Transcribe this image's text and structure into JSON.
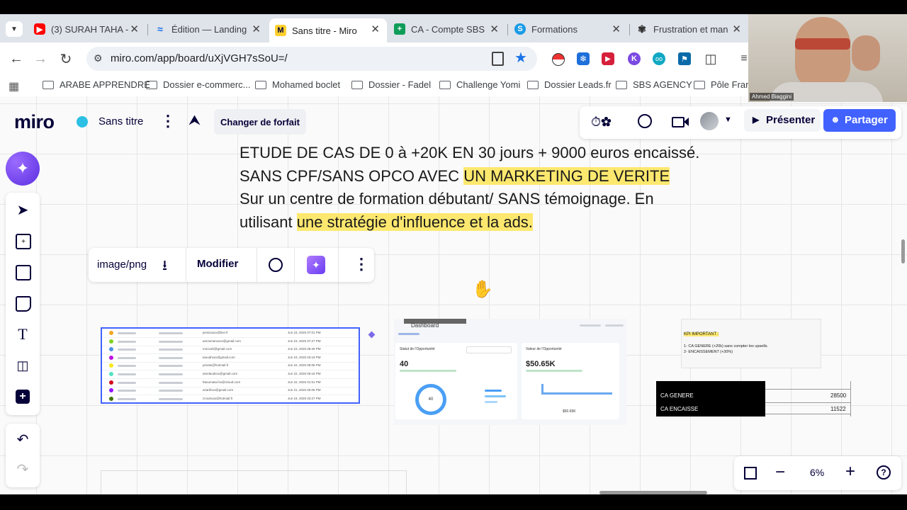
{
  "tabs": [
    {
      "title": "(3) SURAH TAHA -",
      "icon": "youtube-icon",
      "color": "#ff0000"
    },
    {
      "title": "Édition — Landing",
      "icon": "landing-icon",
      "color": "#1a73e8"
    },
    {
      "title": "Sans titre - Miro",
      "icon": "miro-icon",
      "color": "#ffd02f"
    },
    {
      "title": "CA - Compte SBS",
      "icon": "sheets-icon",
      "color": "#0f9d58"
    },
    {
      "title": "Formations",
      "icon": "formations-icon",
      "color": "#1a9be6"
    },
    {
      "title": "Frustration et man",
      "icon": "openai-icon",
      "color": "#333333"
    }
  ],
  "url": "miro.com/app/board/uXjVGH7sSoU=/",
  "bookmarks": [
    "ARABE APPRENDRE",
    "Dossier e-commerc...",
    "Mohamed boclet",
    "Dossier - Fadel",
    "Challenge Yomi",
    "Dossier Leads.fr",
    "SBS AGENCY",
    "Pôle Franc"
  ],
  "webcam": {
    "name": "Ahmed Biaggini"
  },
  "miro": {
    "logo": "miro",
    "board_name": "Sans titre",
    "plan_button": "Changer de forfait",
    "present_button": "Présenter",
    "share_button": "Partager",
    "zoom": "6%"
  },
  "headline": {
    "line1": "ETUDE DE CAS DE 0 à +20K EN 30 jours  + 9000 euros encaissé.",
    "line2_plain": "SANS CPF/SANS OPCO AVEC ",
    "line2_highlight": "UN MARKETING DE VERITE",
    "line3": "Sur un centre de formation débutant/ SANS témoignage. En",
    "line4_plain": "utilisant ",
    "line4_highlight": "une stratégie d'influence et la ads."
  },
  "context_menu": {
    "type_label": "image/png",
    "edit_label": "Modifier"
  },
  "dashboard": {
    "title": "Dashboard",
    "card1_title": "Statut de l'Opportunité",
    "card1_value": "40",
    "card1_donut": "40",
    "card2_title": "Valeur de l'Opportunité",
    "card2_value": "$50.65K",
    "card2_footer": "$50.65K"
  },
  "kpi": {
    "title": "KPI IMPORTANT :",
    "line1": "1- CA GENERE (+20k) sans compter les upsells.",
    "line2": "2- ENCAISSEMENT (+30%)"
  },
  "ca_table": [
    {
      "label": "CA GENERE",
      "value": "28500"
    },
    {
      "label": "CA ENCAISSE",
      "value": "11522"
    }
  ],
  "contacts": [
    {
      "email": "jessicaxxx@live.fr",
      "date": "Jun 23, 2025 07:01 PM"
    },
    {
      "email": "amosmanxxxx@gmail.com",
      "date": "Jun 23, 2025 07:27 PM"
    },
    {
      "email": "moncah@gmail.com",
      "date": "Jun 23, 2025 08:26 PM"
    },
    {
      "email": "taouahxxx@gmail.com",
      "date": "Jun 23, 2025 03:19 PM"
    },
    {
      "email": "privatx@hotmail.fr",
      "date": "Jun 22, 2025 08:08 PM"
    },
    {
      "email": "amelaodxxx@gmail.com",
      "date": "Jun 22, 2025 06:18 PM"
    },
    {
      "email": "fatoumata.fxx@icloud.com",
      "date": "Jun 22, 2025 01:51 PM"
    },
    {
      "email": "azarkhxx@gmail.com",
      "date": "Jun 21, 2025 05:06 PM"
    },
    {
      "email": "zcouhoux@hotmail.fr",
      "date": "Jun 19, 2025 03:27 PM"
    }
  ]
}
